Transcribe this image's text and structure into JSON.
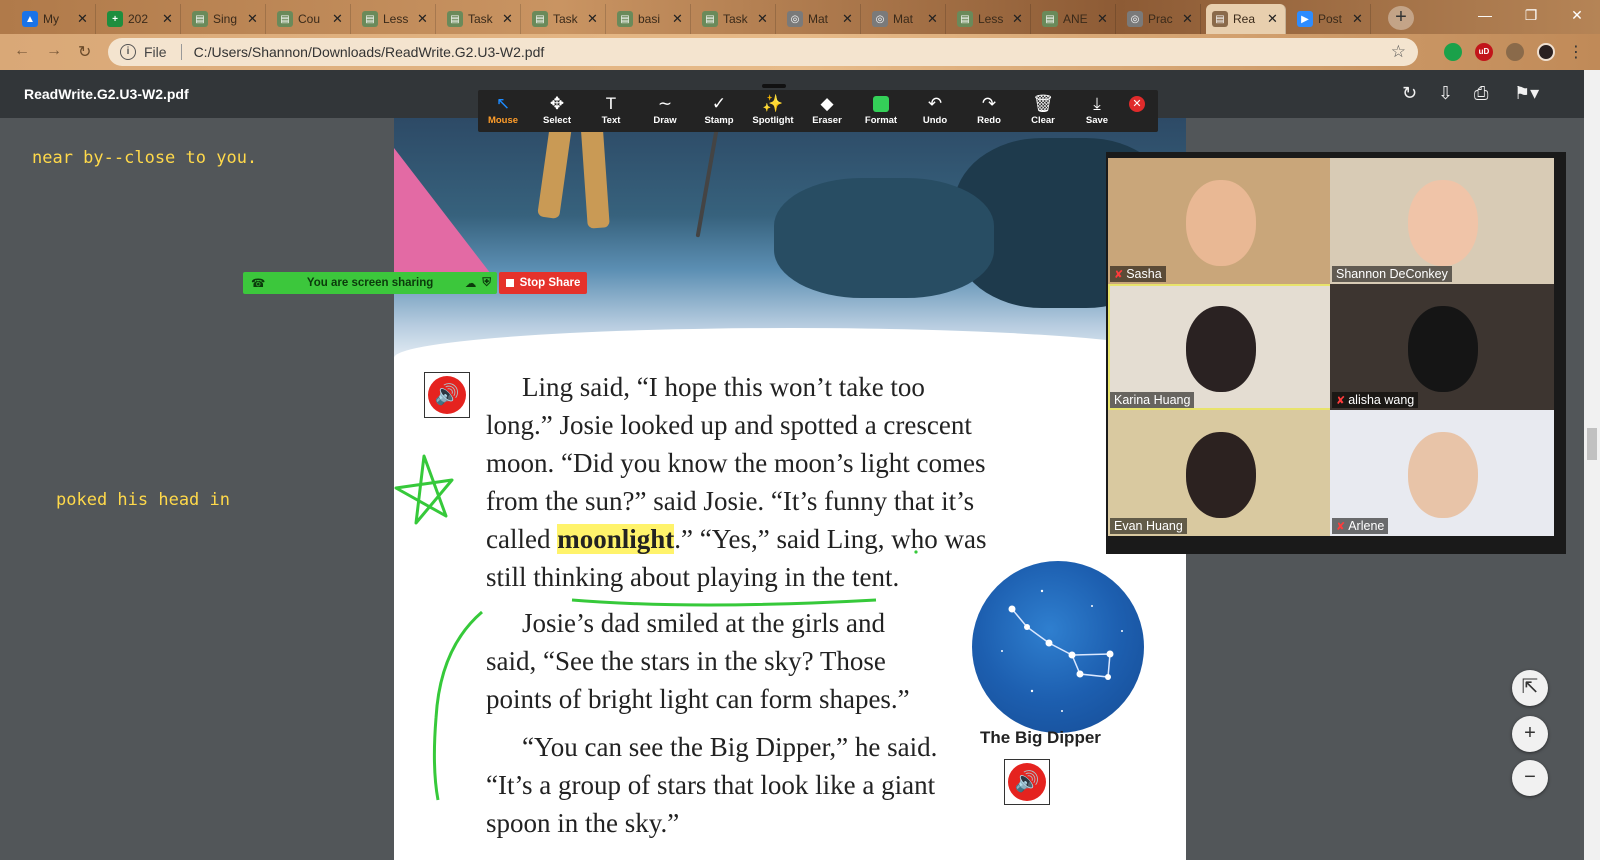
{
  "browser": {
    "tabs": [
      {
        "title": "My ",
        "favicon": "drive-icon",
        "color": "#1a73e8"
      },
      {
        "title": "202",
        "favicon": "sheets-icon",
        "color": "#1e8e3e"
      },
      {
        "title": "Sing",
        "favicon": "doc-icon",
        "color": "#6a8a5a"
      },
      {
        "title": "Cou",
        "favicon": "doc-icon",
        "color": "#6a8a5a"
      },
      {
        "title": "Less",
        "favicon": "doc-icon",
        "color": "#6a8a5a"
      },
      {
        "title": "Task",
        "favicon": "doc-icon",
        "color": "#6a8a5a"
      },
      {
        "title": "Task",
        "favicon": "doc-icon",
        "color": "#6a8a5a"
      },
      {
        "title": "basi",
        "favicon": "doc-icon",
        "color": "#6a8a5a"
      },
      {
        "title": "Task",
        "favicon": "doc-icon",
        "color": "#6a8a5a"
      },
      {
        "title": "Mat",
        "favicon": "globe-icon",
        "color": "#7a7a7a"
      },
      {
        "title": "Mat",
        "favicon": "globe-icon",
        "color": "#7a7a7a"
      },
      {
        "title": "Less",
        "favicon": "doc-icon",
        "color": "#6a8a5a"
      },
      {
        "title": "ANE",
        "favicon": "doc-icon",
        "color": "#6a8a5a"
      },
      {
        "title": "Prac",
        "favicon": "globe-icon",
        "color": "#7a7a7a"
      },
      {
        "title": "Rea",
        "favicon": "pdf-icon",
        "color": "#8a6a4a"
      },
      {
        "title": "Post",
        "favicon": "zoom-icon",
        "color": "#2d8cff"
      }
    ],
    "active_tab_index": 14,
    "address": {
      "scheme": "File",
      "path": "C:/Users/Shannon/Downloads/ReadWrite.G2.U3-W2.pdf"
    }
  },
  "pdf": {
    "title": "ReadWrite.G2.U3-W2.pdf"
  },
  "annotate": {
    "tools": [
      "Mouse",
      "Select",
      "Text",
      "Draw",
      "Stamp",
      "Spotlight",
      "Eraser",
      "Format",
      "Undo",
      "Redo",
      "Clear",
      "Save"
    ],
    "active": "Mouse",
    "format_color": "#34d058"
  },
  "notes": {
    "note1": "near  by--close to you.",
    "note2": "poked his head in"
  },
  "story": {
    "p1": [
      "Ling said, “I hope this won’t take too",
      "long.” Josie looked up and spotted a crescent",
      "moon. “Did you know the moon’s light comes",
      "from the sun?” said Josie. “It’s funny that it’s"
    ],
    "p1_l5_pre": "called ",
    "p1_l5_highlight": "moonlight",
    "p1_l5_post": ".” “Yes,” said Ling, who was",
    "p1_l6": "still thinking about playing in the tent.",
    "p2": [
      "Josie’s dad smiled at the girls and",
      "said, “See the stars in the sky? Those",
      "points of bright light can form shapes.”"
    ],
    "p3": [
      "“You can see the Big Dipper,” he said.",
      "“It’s a group of stars that look like a giant",
      "spoon in the sky.”"
    ],
    "caption": "The Big Dipper"
  },
  "zoom": {
    "sharing_text": "You are screen sharing",
    "stop_share": "Stop Share",
    "participants": [
      {
        "name": "Sasha",
        "muted": true,
        "bg": "#c9a67a"
      },
      {
        "name": "Shannon DeConkey",
        "muted": false,
        "bg": "#d8cbb5"
      },
      {
        "name": "Karina Huang",
        "muted": false,
        "bg": "#e4ddd2",
        "active": true
      },
      {
        "name": "alisha wang",
        "muted": true,
        "bg": "#3d3530"
      },
      {
        "name": "Evan Huang",
        "muted": false,
        "bg": "#d9c9a0"
      },
      {
        "name": "Arlene",
        "muted": true,
        "bg": "#e8eaf0"
      }
    ]
  }
}
